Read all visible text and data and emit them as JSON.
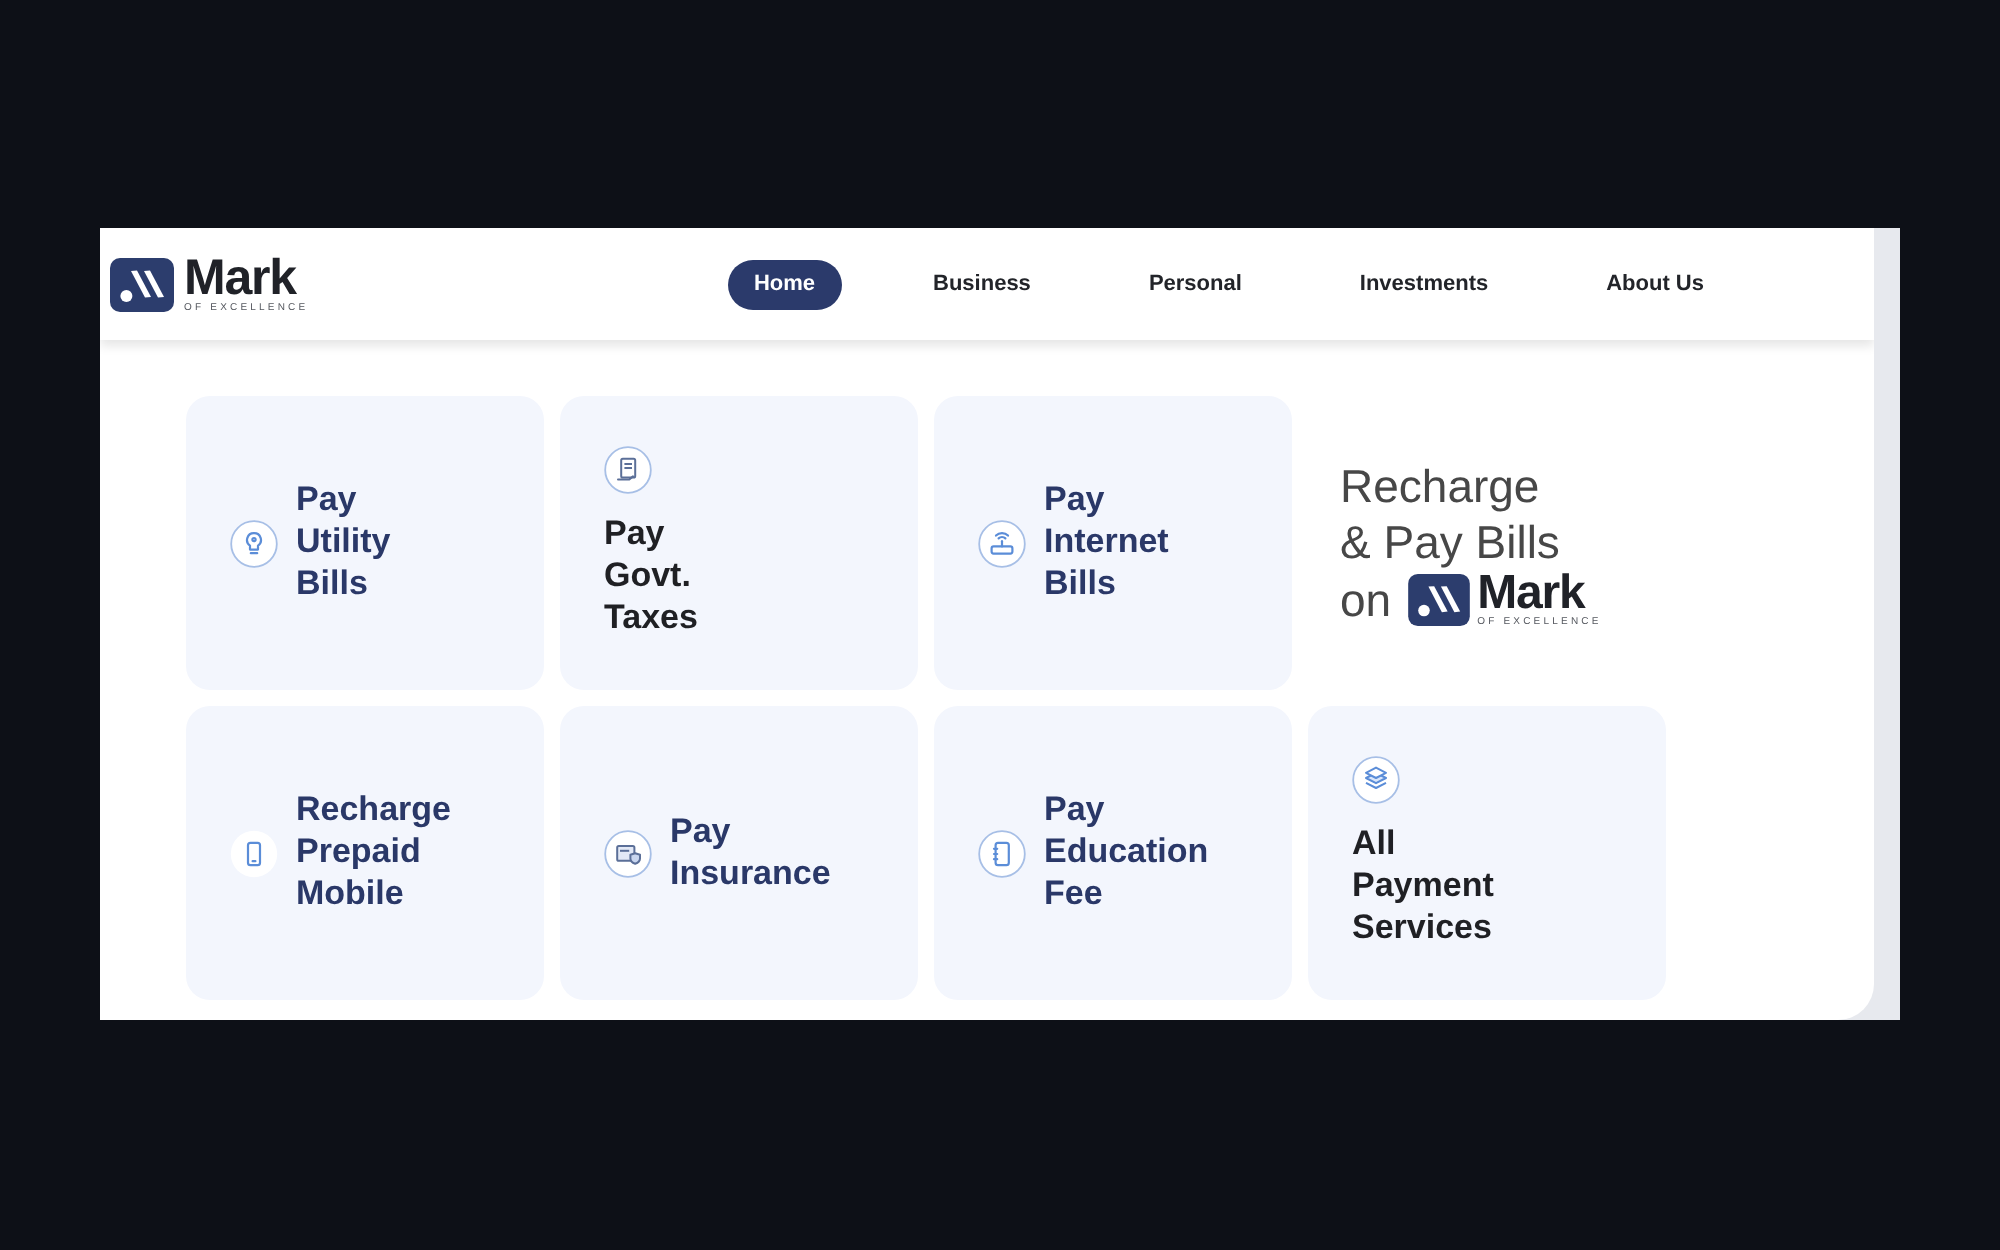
{
  "header": {
    "logo": {
      "name": "Mark",
      "tagline": "OF EXCELLENCE"
    },
    "nav": [
      {
        "label": "Home",
        "selected": true
      },
      {
        "label": "Business",
        "selected": false
      },
      {
        "label": "Personal",
        "selected": false
      },
      {
        "label": "Investments",
        "selected": false
      },
      {
        "label": "About Us",
        "selected": false
      }
    ]
  },
  "services": [
    {
      "label": "Pay Utility Bills",
      "kind": "inline"
    },
    {
      "label": "Pay Govt. Taxes",
      "kind": "stacked"
    },
    {
      "label": "Pay Internet Bills",
      "kind": "inline"
    },
    {
      "label": "Recharge Prepaid Mobile",
      "kind": "inline"
    },
    {
      "label": "Pay Insurance",
      "kind": "inline"
    },
    {
      "label": "Pay Education Fee",
      "kind": "inline"
    },
    {
      "label": "All Payment Services",
      "kind": "stacked"
    }
  ],
  "promo": {
    "lines": [
      "Recharge",
      "& Pay Bills",
      "on"
    ],
    "logo": {
      "name": "Mark",
      "tagline": "OF EXCELLENCE"
    }
  }
}
